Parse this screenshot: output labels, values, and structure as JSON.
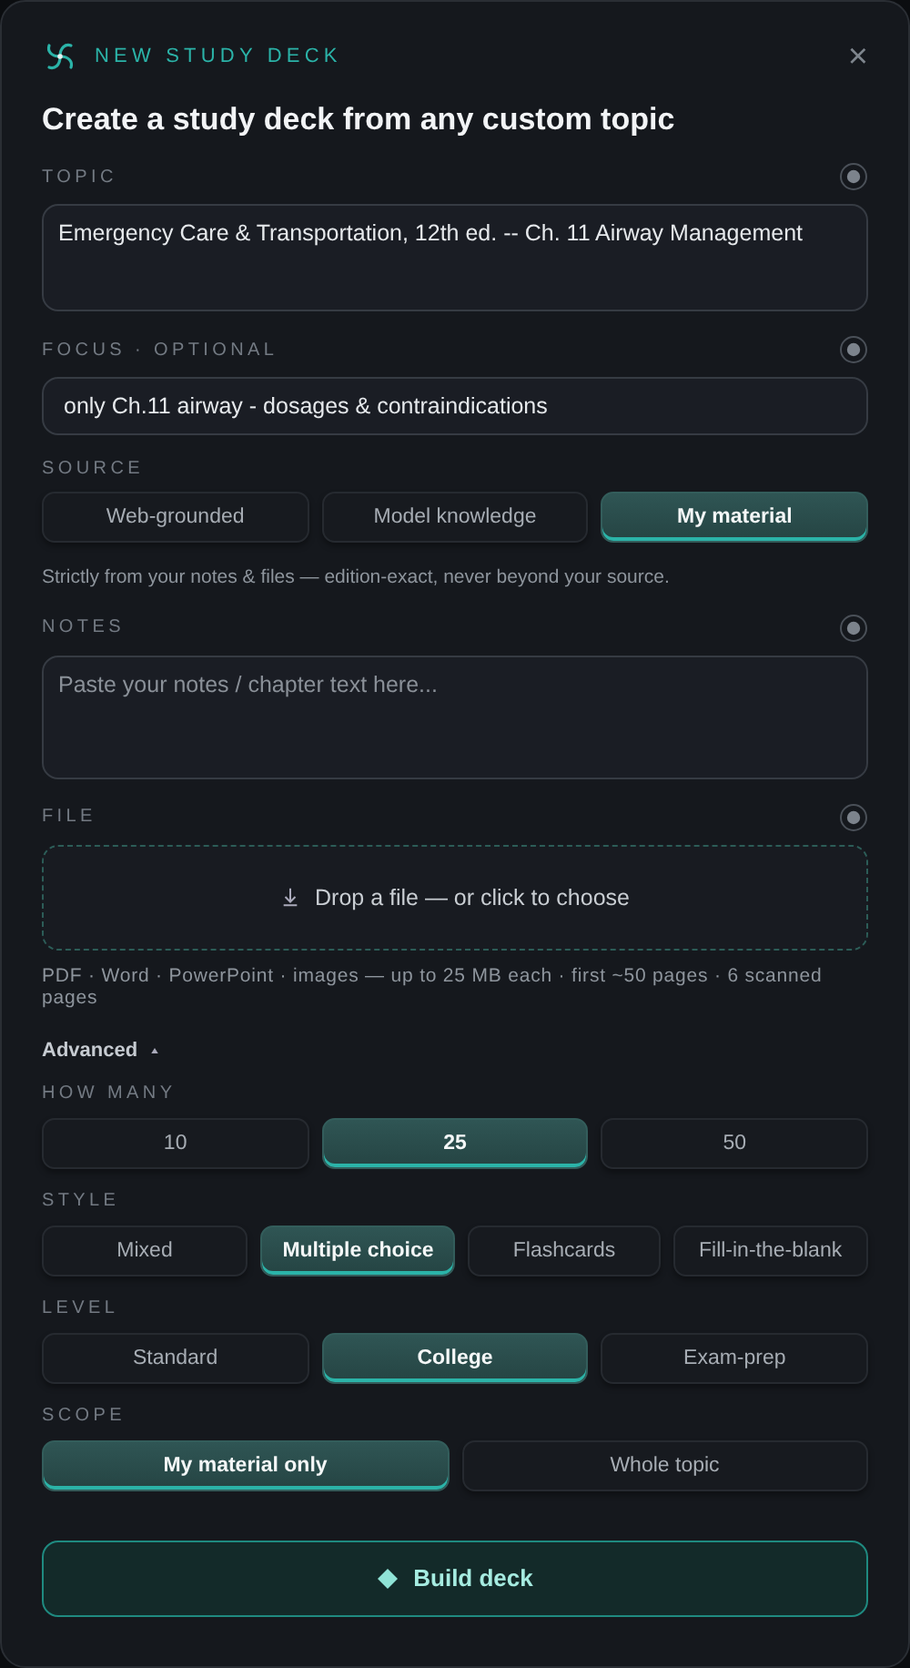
{
  "header": {
    "title": "NEW STUDY DECK",
    "close": "×"
  },
  "heading": "Create a study deck from any custom topic",
  "sections": [
    {
      "kind": "textarea",
      "label": "TOPIC",
      "value": "Emergency Care & Transportation, 12th ed. -- Ch. 11 Airway Management"
    },
    {
      "kind": "input",
      "label": "FOCUS · OPTIONAL",
      "value": "only Ch.11 airway - dosages & contraindications"
    },
    {
      "kind": "choice",
      "label": "SOURCE",
      "options": [
        {
          "label": "Web-grounded",
          "selected": false
        },
        {
          "label": "Model knowledge",
          "selected": false
        },
        {
          "label": "My material",
          "selected": true
        }
      ],
      "hint": "Strictly from your notes & files — edition-exact, never beyond your source."
    },
    {
      "kind": "textarea",
      "label": "NOTES",
      "placeholder": "Paste your notes / chapter text here..."
    },
    {
      "kind": "dropzone",
      "label": "FILE",
      "text": "Drop a file — or click to choose",
      "hint": "PDF · Word · PowerPoint · images — up to 25 MB each · first ~50 pages · 6 scanned pages"
    }
  ],
  "advanced": {
    "label": "Advanced",
    "expanded": true
  },
  "groups": [
    {
      "label": "HOW MANY",
      "options": [
        {
          "label": "10",
          "selected": false
        },
        {
          "label": "25",
          "selected": true
        },
        {
          "label": "50",
          "selected": false
        }
      ]
    },
    {
      "label": "STYLE",
      "options": [
        {
          "label": "Mixed",
          "selected": false
        },
        {
          "label": "Multiple choice",
          "selected": true
        },
        {
          "label": "Flashcards",
          "selected": false
        },
        {
          "label": "Fill-in-the-blank",
          "selected": false
        }
      ]
    },
    {
      "label": "LEVEL",
      "options": [
        {
          "label": "Standard",
          "selected": false
        },
        {
          "label": "College",
          "selected": true
        },
        {
          "label": "Exam-prep",
          "selected": false
        }
      ]
    },
    {
      "label": "SCOPE",
      "options": [
        {
          "label": "My material only",
          "selected": true
        },
        {
          "label": "Whole topic",
          "selected": false
        }
      ]
    }
  ],
  "build_button": "Build deck"
}
